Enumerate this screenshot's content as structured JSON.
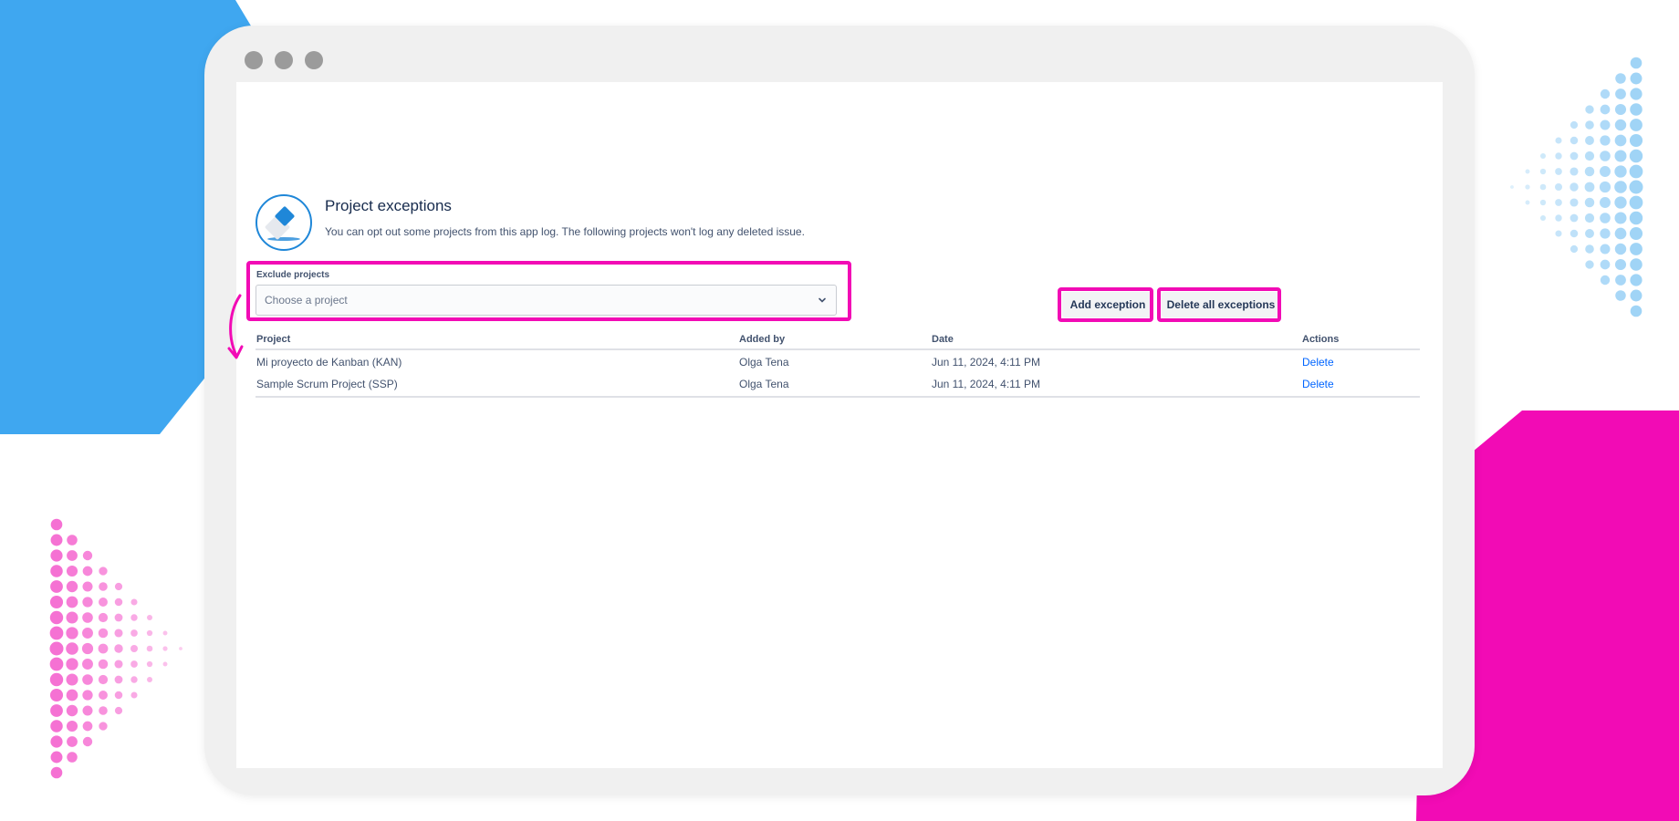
{
  "page": {
    "title": "Project exceptions",
    "subtitle": "You can opt out some projects from this app log. The following projects won't log any deleted issue."
  },
  "form": {
    "label": "Exclude projects",
    "placeholder": "Choose a project"
  },
  "buttons": {
    "add": "Add exception",
    "delete_all": "Delete all exceptions"
  },
  "table": {
    "headers": {
      "project": "Project",
      "added_by": "Added by",
      "date": "Date",
      "actions": "Actions"
    },
    "rows": [
      {
        "project": "Mi proyecto de Kanban (KAN)",
        "added_by": "Olga Tena",
        "date": "Jun 11, 2024, 4:11 PM",
        "action": "Delete"
      },
      {
        "project": "Sample Scrum Project (SSP)",
        "added_by": "Olga Tena",
        "date": "Jun 11, 2024, 4:11 PM",
        "action": "Delete"
      }
    ]
  },
  "icons": {
    "app": "eraser-icon",
    "dropdown": "chevron-down-icon",
    "annotation": "curved-arrow-icon"
  },
  "colors": {
    "highlight": "#f20bb5",
    "link": "#0065ff",
    "accent_blue": "#3fa7f0",
    "accent_pink": "#f20bb5"
  }
}
